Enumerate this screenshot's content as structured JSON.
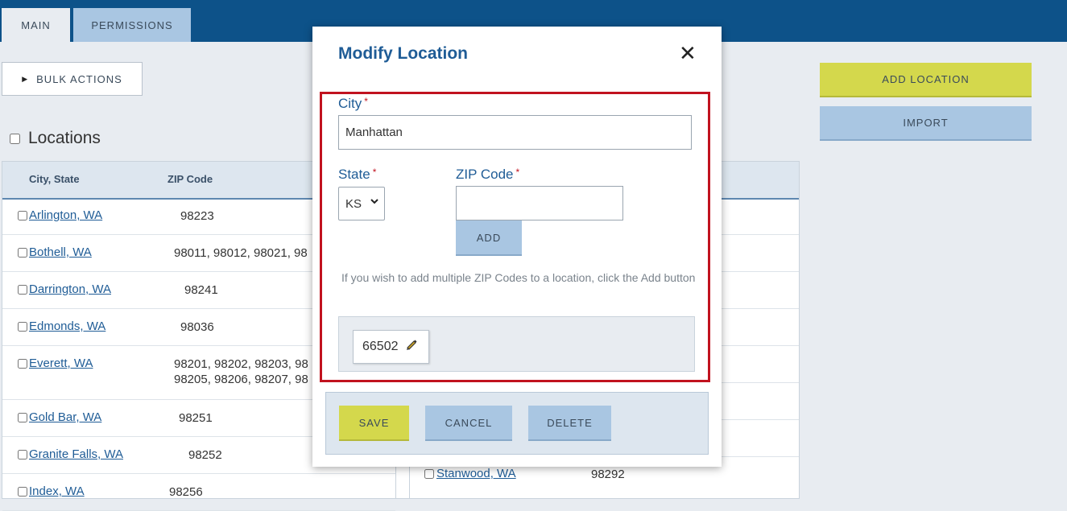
{
  "tabs": {
    "main": "MAIN",
    "permissions": "PERMISSIONS"
  },
  "bulk_actions": {
    "icon": "play-triangle-icon",
    "label": "BULK ACTIONS"
  },
  "locations_title": "Locations",
  "table": {
    "columns": {
      "city_state": "City, State",
      "zip": "ZIP Code"
    },
    "rows": [
      {
        "city": "Arlington, WA",
        "zip": "98223"
      },
      {
        "city": "Bothell, WA",
        "zip": "98011, 98012, 98021, 98"
      },
      {
        "city": "Darrington, WA",
        "zip": "98241"
      },
      {
        "city": "Edmonds, WA",
        "zip": "98036"
      },
      {
        "city": "Everett, WA",
        "zip": "98201, 98202, 98203, 98\n98205, 98206, 98207, 98"
      },
      {
        "city": "Gold Bar, WA",
        "zip": "98251"
      },
      {
        "city": "Granite Falls, WA",
        "zip": "98252"
      },
      {
        "city": "Index, WA",
        "zip": "98256"
      }
    ],
    "right_rows": [
      {
        "city": "Stanwood, WA",
        "zip": "98292"
      }
    ]
  },
  "buttons": {
    "add_location": "ADD LOCATION",
    "import": "IMPORT"
  },
  "modal": {
    "title": "Modify Location",
    "close_icon": "close-icon",
    "required_marker": "*",
    "city_label": "City",
    "city_value": "Manhattan",
    "state_label": "State",
    "state_value": "KS",
    "zip_label": "ZIP Code",
    "zip_value": "",
    "add_button": "ADD",
    "hint": "If you wish to add multiple ZIP Codes to a location, click the Add button",
    "zip_codes": [
      "66502"
    ],
    "edit_icon": "pencil-icon",
    "save": "SAVE",
    "cancel": "CANCEL",
    "delete": "DELETE"
  },
  "colors": {
    "header_blue": "#0d5289",
    "accent_yellow": "#d4d84c",
    "secondary_blue": "#a9c6e2",
    "highlight_red": "#c1121f",
    "title_blue": "#1f5c96"
  }
}
